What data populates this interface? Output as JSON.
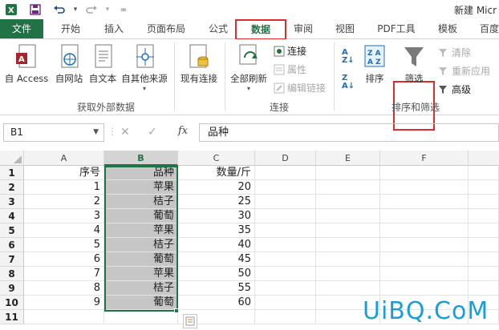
{
  "title_bar": {
    "doc_title": "新建 Micr"
  },
  "tabs": [
    {
      "id": "file",
      "label": "文件"
    },
    {
      "id": "home",
      "label": "开始"
    },
    {
      "id": "insert",
      "label": "插入"
    },
    {
      "id": "layout",
      "label": "页面布局"
    },
    {
      "id": "formulas",
      "label": "公式"
    },
    {
      "id": "data",
      "label": "数据"
    },
    {
      "id": "review",
      "label": "审阅"
    },
    {
      "id": "view",
      "label": "视图"
    },
    {
      "id": "pdf",
      "label": "PDF工具"
    },
    {
      "id": "template",
      "label": "模板"
    },
    {
      "id": "baidu",
      "label": "百度"
    }
  ],
  "ribbon": {
    "external_data": {
      "label": "获取外部数据",
      "buttons": [
        "自 Access",
        "自网站",
        "自文本",
        "自其他来源"
      ],
      "existing": "现有连接"
    },
    "connections": {
      "label": "连接",
      "refresh_all": "全部刷新",
      "connections": "连接",
      "properties": "属性",
      "edit_links": "编辑链接"
    },
    "sort_filter": {
      "label": "排序和筛选",
      "sort": "排序",
      "filter": "筛选",
      "clear": "清除",
      "reapply": "重新应用",
      "advanced": "高级"
    }
  },
  "formula_bar": {
    "name_box": "B1",
    "fx": "fx",
    "value": "品种"
  },
  "columns": [
    "A",
    "B",
    "C",
    "D",
    "E",
    "F"
  ],
  "rows": [
    {
      "n": "1",
      "a": "序号",
      "b": "品种",
      "c": "数量/斤"
    },
    {
      "n": "2",
      "a": "1",
      "b": "苹果",
      "c": "20"
    },
    {
      "n": "3",
      "a": "2",
      "b": "桔子",
      "c": "25"
    },
    {
      "n": "4",
      "a": "3",
      "b": "葡萄",
      "c": "30"
    },
    {
      "n": "5",
      "a": "4",
      "b": "苹果",
      "c": "35"
    },
    {
      "n": "6",
      "a": "5",
      "b": "桔子",
      "c": "40"
    },
    {
      "n": "7",
      "a": "6",
      "b": "葡萄",
      "c": "45"
    },
    {
      "n": "8",
      "a": "7",
      "b": "苹果",
      "c": "50"
    },
    {
      "n": "9",
      "a": "8",
      "b": "桔子",
      "c": "55"
    },
    {
      "n": "10",
      "a": "9",
      "b": "葡萄",
      "c": "60"
    },
    {
      "n": "11",
      "a": "",
      "b": "",
      "c": ""
    }
  ],
  "watermark": "UiBQ.CoM",
  "colors": {
    "excel_green": "#217346",
    "highlight_red": "#e02b2b",
    "watermark_blue": "#1a9edb"
  }
}
